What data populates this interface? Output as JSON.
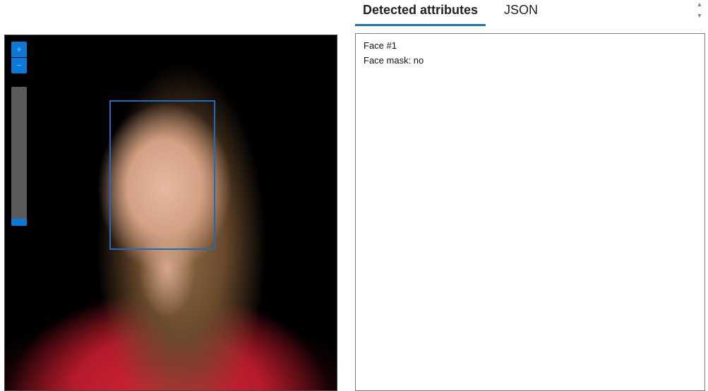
{
  "tabs": [
    {
      "label": "Detected attributes",
      "active": true
    },
    {
      "label": "JSON",
      "active": false
    }
  ],
  "viewer": {
    "zoom_in_label": "+",
    "zoom_out_label": "−",
    "zoom_level": 0.05
  },
  "attributes": {
    "face_heading": "Face #1",
    "face_mask": "Face mask: no"
  },
  "colors": {
    "accent": "#1a73c9",
    "control_blue": "#0a7ad6",
    "face_box": "#1f6bc2"
  }
}
